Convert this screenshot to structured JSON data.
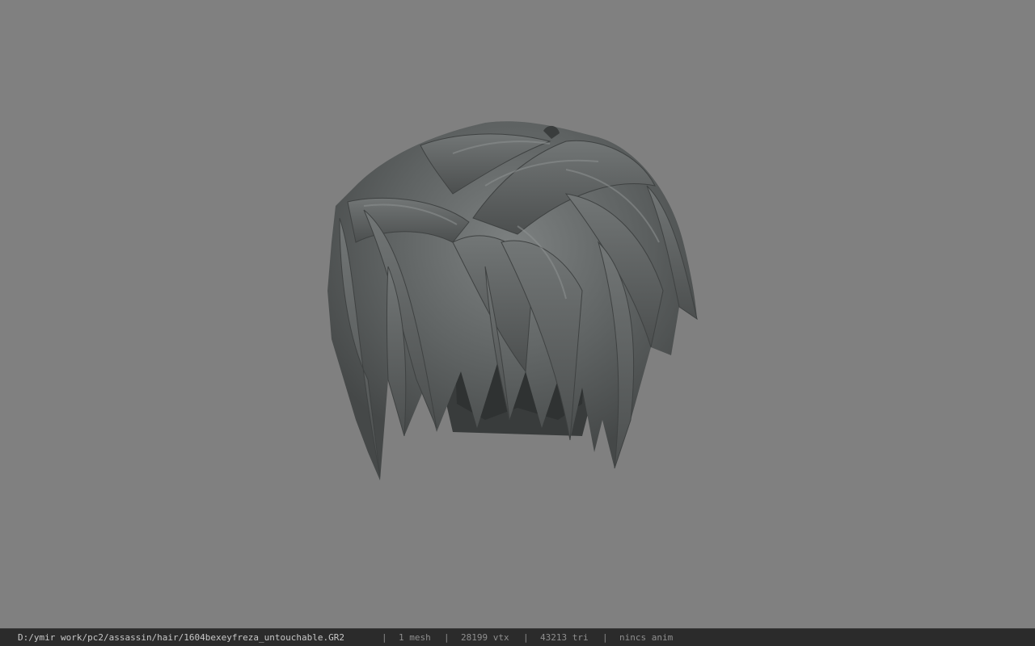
{
  "viewport": {
    "background": "#808080",
    "model": {
      "icon": "hair-mesh-model",
      "base_color": "#5f6363",
      "dark_color": "#2e3131",
      "highlight_color": "#8e9292"
    }
  },
  "statusbar": {
    "file_path": "D:/ymir work/pc2/assassin/hair/1604bexeyfreza_untouchable.GR2",
    "separator": "|",
    "mesh_count": "1 mesh",
    "vertex_count": "28199 vtx",
    "triangle_count": "43213 tri",
    "anim_status": "nincs anim",
    "background": "#2b2b2b",
    "text_color": "#c8c8c8"
  }
}
